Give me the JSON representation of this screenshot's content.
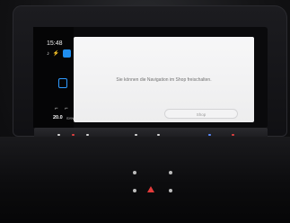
{
  "status_bar": {
    "time": "15:48",
    "icons": "♪ ⚡"
  },
  "sidebar": {
    "home_icon": "home-icon",
    "app_icon": "app-icon"
  },
  "climate": {
    "seat_icons": "⌐ ⌐",
    "temperature": "20.0",
    "sync_label": "SYNC"
  },
  "dialog": {
    "message": "Sie können die Navigation im Shop freischalten.",
    "button_label": "Shop"
  },
  "colors": {
    "accent": "#1f8ef0",
    "hazard": "#e33b3b"
  }
}
